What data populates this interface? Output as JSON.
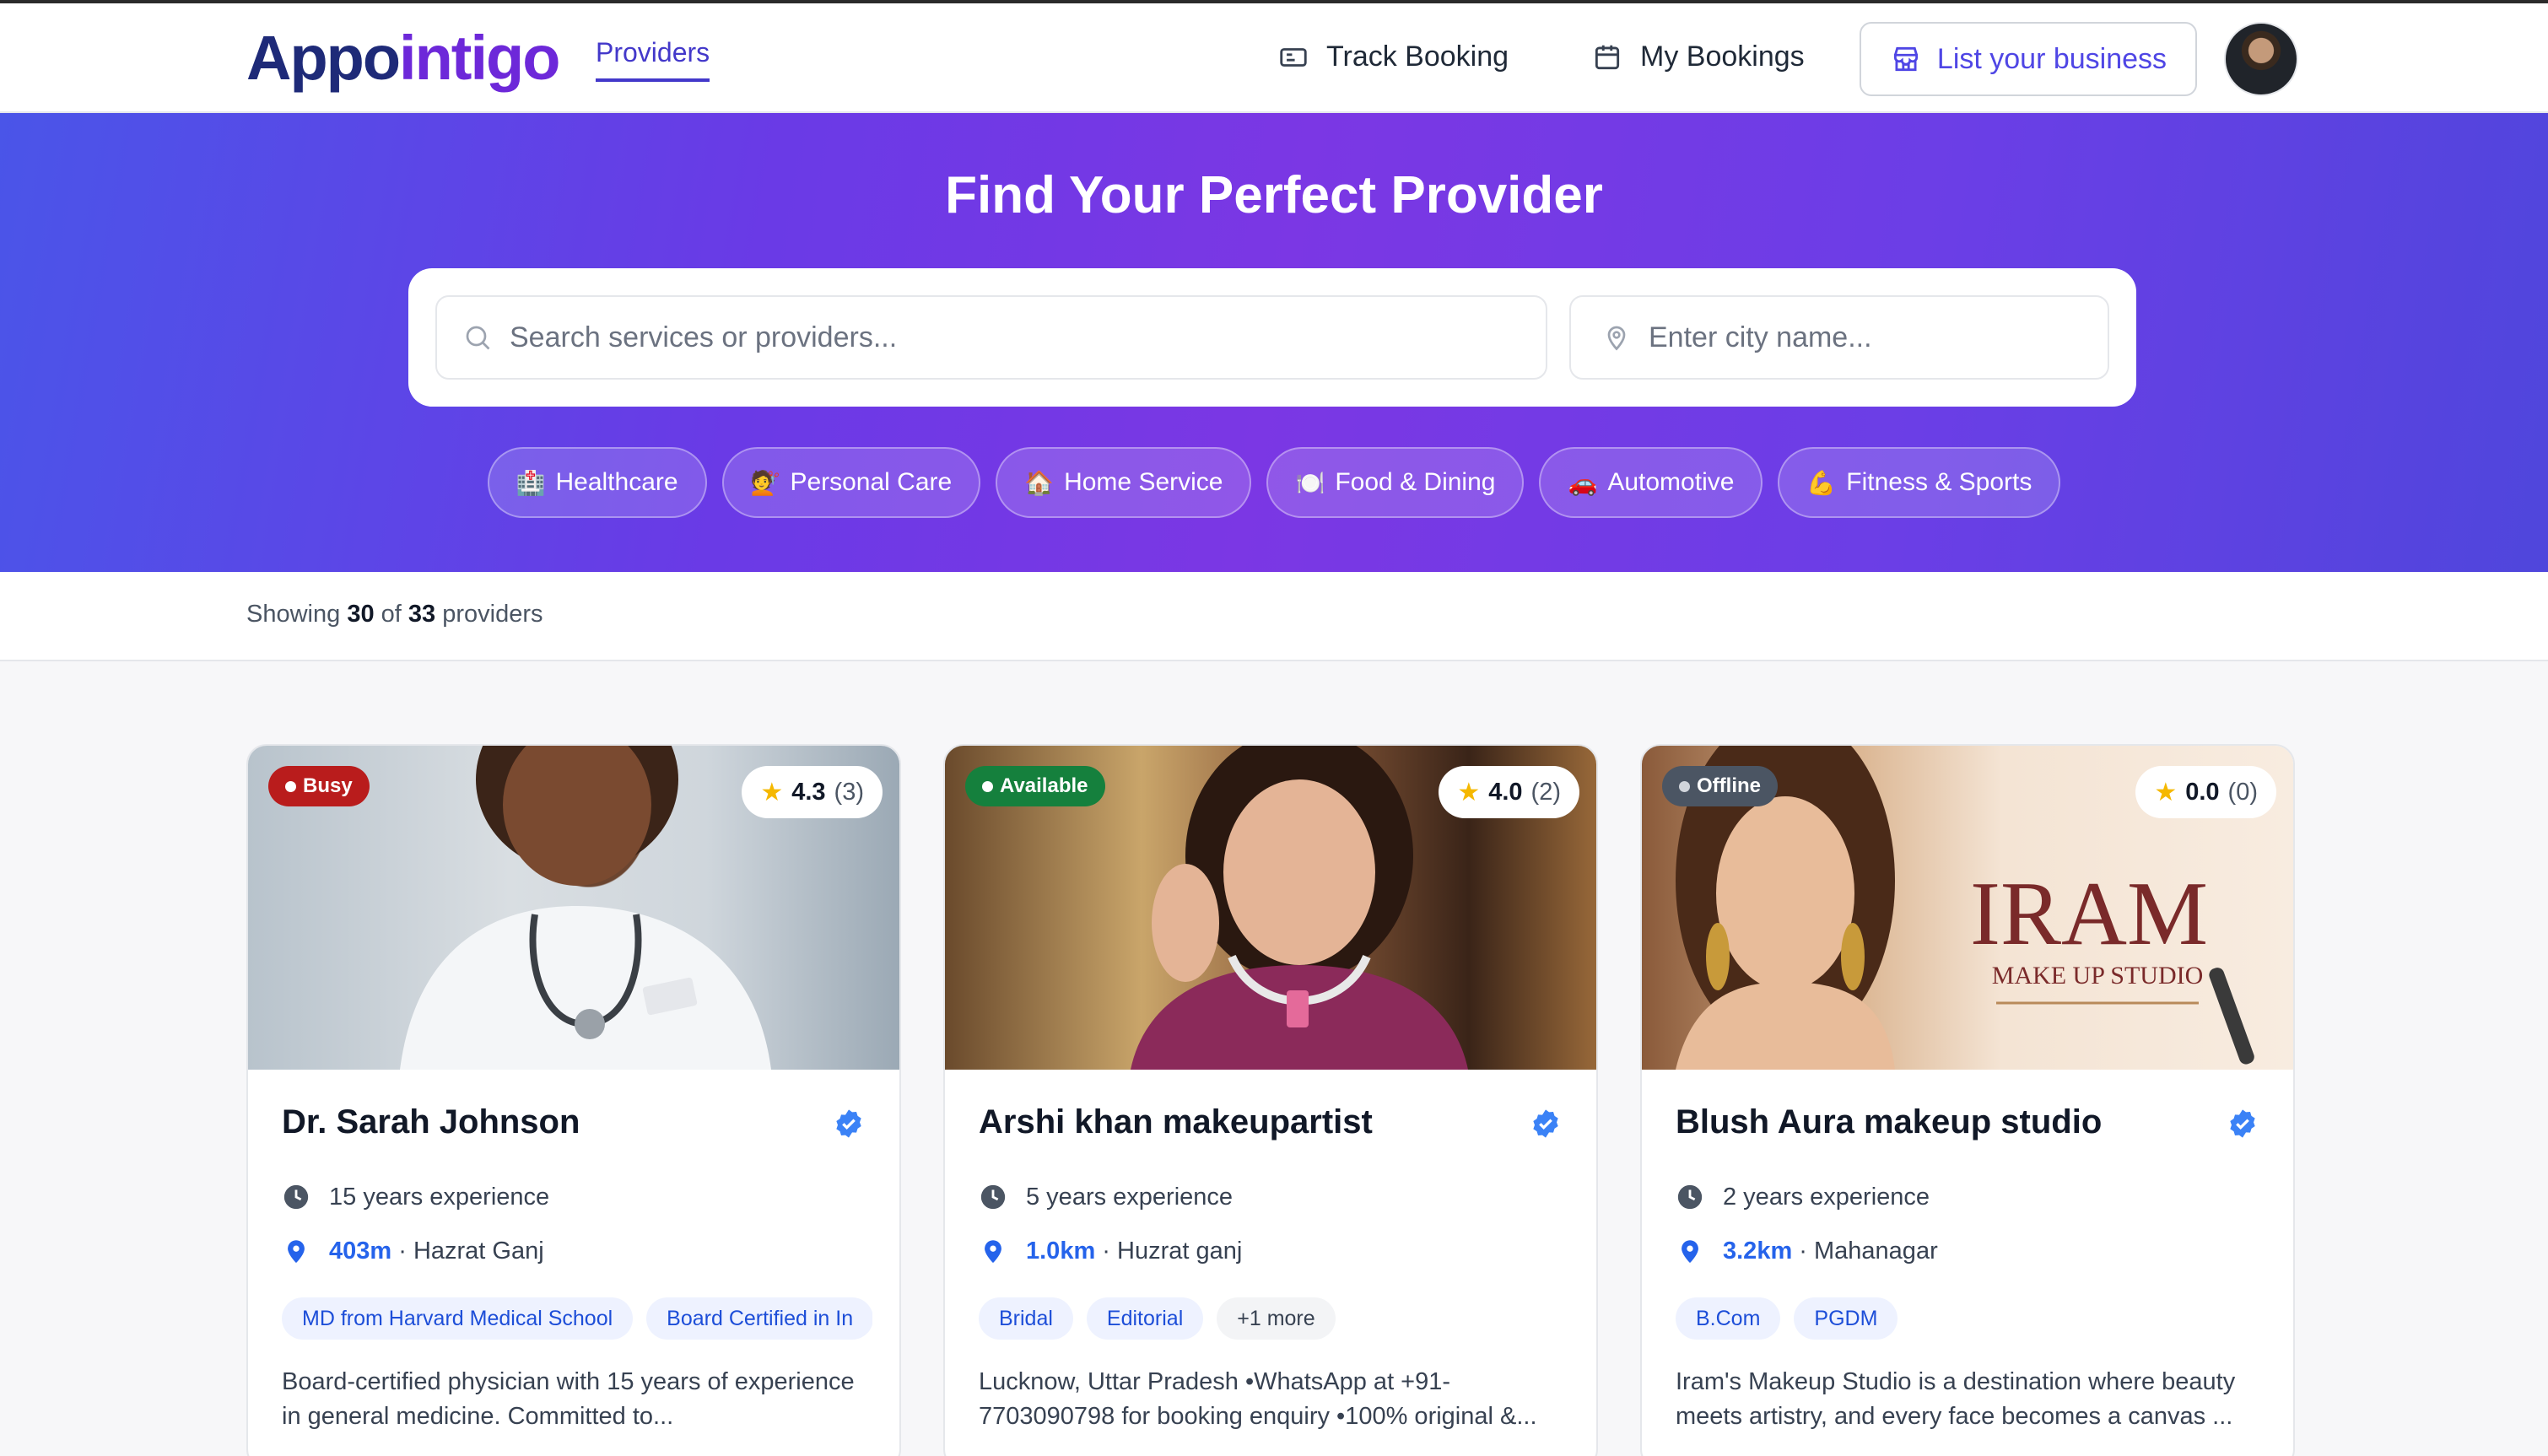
{
  "header": {
    "logo_part1": "Appo",
    "logo_part2": "intigo",
    "nav_providers": "Providers",
    "track_booking": "Track Booking",
    "my_bookings": "My Bookings",
    "list_business": "List your business"
  },
  "hero": {
    "title": "Find Your Perfect Provider",
    "search_placeholder": "Search services or providers...",
    "city_placeholder": "Enter city name...",
    "categories": [
      {
        "emoji": "🏥",
        "label": "Healthcare"
      },
      {
        "emoji": "💇",
        "label": "Personal Care"
      },
      {
        "emoji": "🏠",
        "label": "Home Service"
      },
      {
        "emoji": "🍽️",
        "label": "Food & Dining"
      },
      {
        "emoji": "🚗",
        "label": "Automotive"
      },
      {
        "emoji": "💪",
        "label": "Fitness & Sports"
      }
    ]
  },
  "results": {
    "prefix": "Showing",
    "shown": "30",
    "of": "of",
    "total": "33",
    "suffix": "providers"
  },
  "colors": {
    "busy": "#b91c1c",
    "available": "#15803d",
    "offline": "#4b5563",
    "accent": "#4338ca"
  },
  "providers": [
    {
      "status": "Busy",
      "rating": "4.3",
      "reviews": "(3)",
      "name": "Dr. Sarah Johnson",
      "experience": "15 years experience",
      "distance": "403m",
      "area": "· Hazrat Ganj",
      "tags": [
        "MD from Harvard Medical School",
        "Board Certified in In"
      ],
      "more": "",
      "description": "Board-certified physician with 15 years of experience in general medicine. Committed to..."
    },
    {
      "status": "Available",
      "rating": "4.0",
      "reviews": "(2)",
      "name": "Arshi khan makeupartist",
      "experience": "5 years experience",
      "distance": "1.0km",
      "area": "· Huzrat ganj",
      "tags": [
        "Bridal",
        "Editorial"
      ],
      "more": "+1 more",
      "description": "Lucknow, Uttar Pradesh •WhatsApp at +91-7703090798 for booking enquiry •100% original &..."
    },
    {
      "status": "Offline",
      "rating": "0.0",
      "reviews": "(0)",
      "name": "Blush Aura makeup studio",
      "experience": "2 years experience",
      "distance": "3.2km",
      "area": "· Mahanagar",
      "tags": [
        "B.Com",
        "PGDM"
      ],
      "more": "",
      "description": "Iram's Makeup Studio is a destination where beauty meets artistry, and every face becomes a canvas ...",
      "image_brand": "IRAM",
      "image_brand_sub": "MAKE UP STUDIO"
    }
  ]
}
